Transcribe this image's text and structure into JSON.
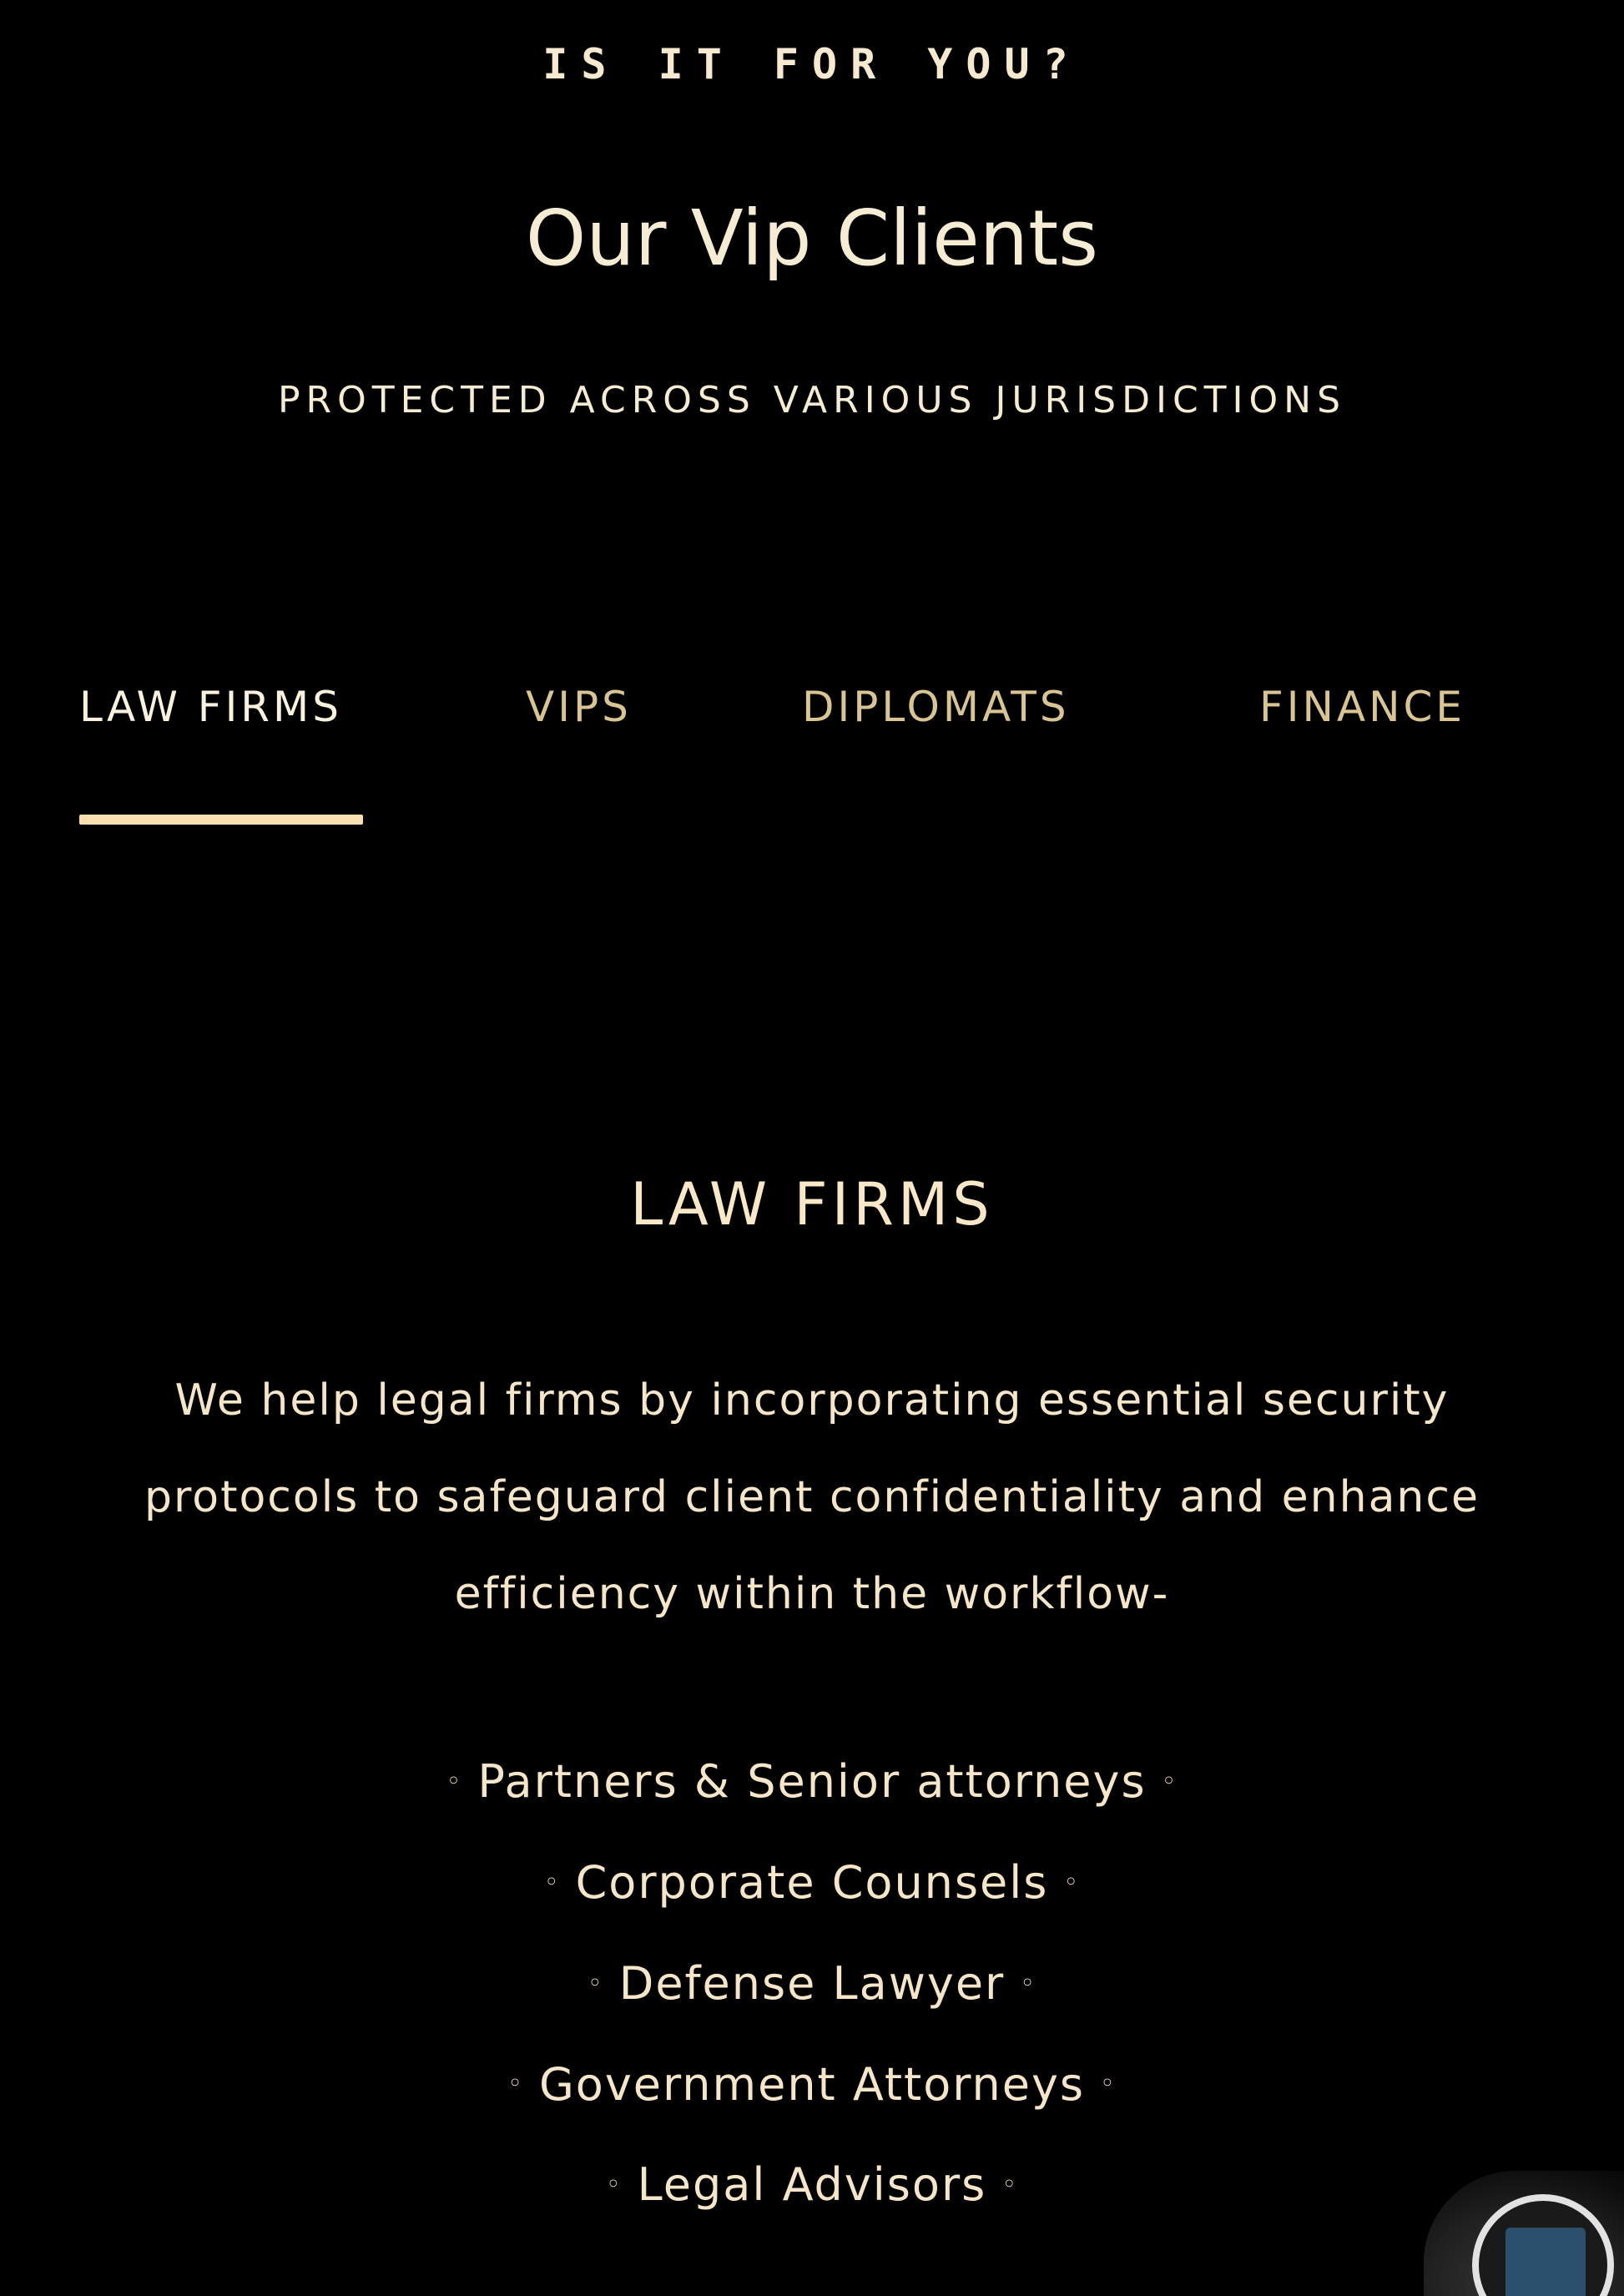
{
  "header": {
    "eyebrow": "IS IT FOR YOU?",
    "title": "Our Vip Clients",
    "subtitle": "PROTECTED ACROSS VARIOUS JURISDICTIONS"
  },
  "tabs": [
    {
      "label": "LAW FIRMS",
      "active": true
    },
    {
      "label": "VIPS",
      "active": false
    },
    {
      "label": "DIPLOMATS",
      "active": false
    },
    {
      "label": "FINANCE",
      "active": false
    }
  ],
  "panel": {
    "heading": "LAW FIRMS",
    "description": "We help legal firms by incorporating essential security protocols to safeguard client confidentiality and enhance efficiency within the workflow-",
    "bullet_glyph": "◦",
    "items": [
      "Partners & Senior attorneys",
      "Corporate Counsels",
      "Defense Lawyer",
      "Government Attorneys",
      "Legal Advisors"
    ]
  },
  "colors": {
    "background": "#000000",
    "text": "#f6e9cf",
    "tab_inactive": "#d9c594",
    "underline": "#f9deb2"
  },
  "icons": {
    "chat_widget": "chat-launcher-icon"
  }
}
